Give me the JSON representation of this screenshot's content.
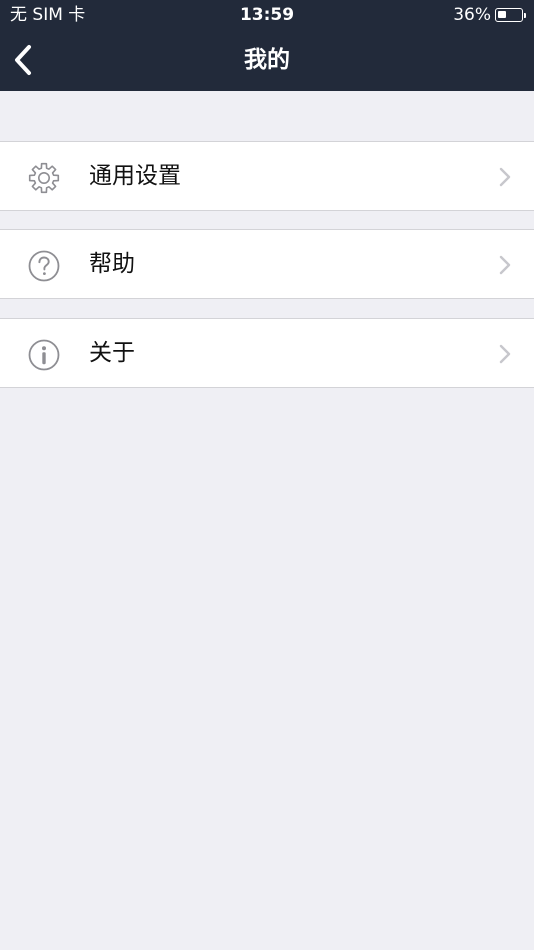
{
  "status_bar": {
    "carrier": "无 SIM 卡",
    "time": "13:59",
    "battery_percent_label": "36%",
    "battery_level": 0.36
  },
  "nav": {
    "title": "我的",
    "back_icon": "chevron-left-icon"
  },
  "menu": {
    "items": [
      {
        "label": "通用设置",
        "icon": "gear-icon"
      },
      {
        "label": "帮助",
        "icon": "question-circle-icon"
      },
      {
        "label": "关于",
        "icon": "info-circle-icon"
      }
    ],
    "chevron_icon": "chevron-right-icon"
  },
  "colors": {
    "nav_background": "#222a3a",
    "page_background": "#efeff4",
    "row_background": "#ffffff",
    "icon_gray": "#8e8e93",
    "chevron_gray": "#c7c7cc"
  }
}
